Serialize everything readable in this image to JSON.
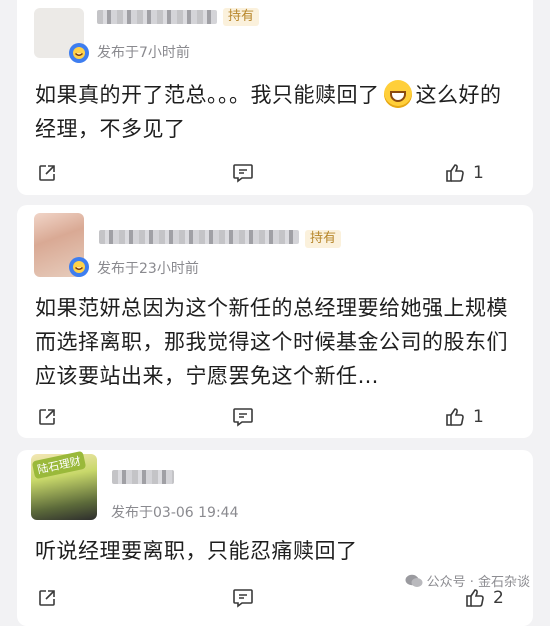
{
  "comments": [
    {
      "holder_tag": "持有",
      "posted": "发布于7小时前",
      "content": [
        "如果真的开了范总。。。我只能赎回了",
        "这么好的经理，不多见了"
      ],
      "like_count": "1",
      "avatar_color": "#e8e6e3"
    },
    {
      "holder_tag": "持有",
      "posted": "发布于23小时前",
      "content": "如果范妍总因为这个新任的总经理要给她强上规模而选择离职，那我觉得这个时候基金公司的股东们应该要站出来，宁愿罢免这个新任…",
      "like_count": "1",
      "avatar_color": "#d8b8a8"
    },
    {
      "badge_text": "陆石理财",
      "posted": "发布于03-06 19:44",
      "content": "听说经理要离职，只能忍痛赎回了",
      "like_count": "2",
      "avatar_color": "#c9d77a"
    }
  ],
  "watermark": "公众号 · 金石杂谈",
  "colors": {
    "background": "#f2f2f4",
    "card": "#ffffff",
    "meta_text": "#8a8a8f",
    "holder_tag_bg": "#fbf1dc",
    "holder_tag_text": "#b7862a",
    "accent_blue": "#3e7ef0"
  },
  "icons": [
    "share-icon",
    "comment-icon",
    "like-icon",
    "emoji-badge-icon",
    "grin-emoji-icon",
    "wechat-icon"
  ]
}
